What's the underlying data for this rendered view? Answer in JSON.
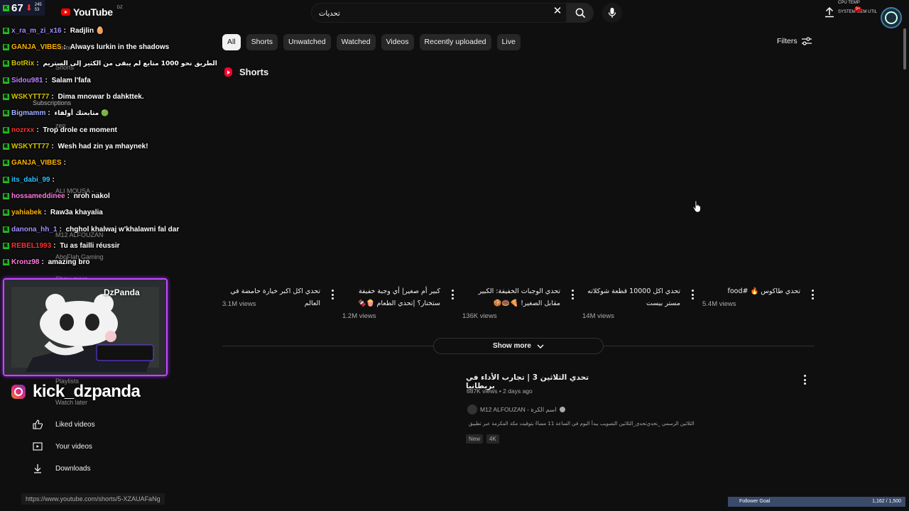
{
  "header": {
    "logo_text": "YouTube",
    "country": "DZ",
    "search_value": "تحديات",
    "sys_line1": "CPU TEMP",
    "sys_line2": "SYSTEM MEM UTIL",
    "notif_count": "9+"
  },
  "chips": [
    "All",
    "Shorts",
    "Unwatched",
    "Watched",
    "Videos",
    "Recently uploaded",
    "Live"
  ],
  "filters_label": "Filters",
  "shorts": {
    "heading": "Shorts",
    "items": [
      {
        "title": "تحدي اكل اكبر خيارة حامضة في العالم",
        "views": "3.1M views"
      },
      {
        "title": "كبير أم صغير| أي وجبة خفيفة ستختار؟ |تحدي الطعام 🍿🍫",
        "views": "1.2M views"
      },
      {
        "title": "تحدي الوجبات الخفيفة: الكبير مقابل الصغير! 🍕🍩🍪",
        "views": "136K views"
      },
      {
        "title": "تحدي اكل 10000 قطعة شوكلاته مستر بيست",
        "views": "14M views"
      },
      {
        "title": "تحدي طاكوس 🔥 #food",
        "views": "5.4M views"
      }
    ],
    "show_more": "Show more"
  },
  "video": {
    "title": "تحدي الثلاثين 3 | تجارب الأداء في بريطانيا",
    "meta": "687K views • 2 days ago",
    "channel": "M12 ALFOUZAN - اسم الكرة",
    "description": "الثلاثين الرسمي _تحدي‌تحدي_الثلاثين التصويب يبدأ اليوم في الساعة 11 مساءً بتوقيت مكة المكرمة عبر تطبيق",
    "badges": [
      "New",
      "4K"
    ]
  },
  "sidebar": {
    "faded": [
      "Home",
      "Shorts",
      "Subscriptions",
      "zen",
      "ALI MOUSA - ...",
      "M12 ALFOUZAN",
      "AboFlah Gaming",
      "Show more",
      "Playlists",
      "Watch later"
    ],
    "items": [
      {
        "label": "Liked videos",
        "icon": "thumbs-up-icon"
      },
      {
        "label": "Your videos",
        "icon": "video-icon"
      },
      {
        "label": "Downloads",
        "icon": "download-icon"
      }
    ]
  },
  "stream": {
    "viewers": "67",
    "stat_a": "245",
    "stat_b": "53",
    "chat": [
      {
        "user": "x_ra_m_zi_x16",
        "color": "#a58cff",
        "msg": "Radjlin 🥚"
      },
      {
        "user": "GANJA_VIBES",
        "color": "#ffb400",
        "msg": "Always lurkin in the shadows"
      },
      {
        "user": "BotRix",
        "color": "#d4c400",
        "msg": "الطريق نحو 1000 متابع لم يبقى من الكثير إلى الستريم"
      },
      {
        "user": "Sidou981",
        "color": "#c080ff",
        "msg": "Salam l'fafa"
      },
      {
        "user": "WSKYTT77",
        "color": "#d4c400",
        "msg": "Dima mnowar b dahkttek."
      },
      {
        "user": "Bigmamm",
        "color": "#9fb0ff",
        "msg": "متابعتك أولفاء 🟢"
      },
      {
        "user": "nozrxx",
        "color": "#ff3030",
        "msg": "Trop drole ce moment"
      },
      {
        "user": "WSKYTT77",
        "color": "#d4c400",
        "msg": "Wesh had zin ya mhaynek!"
      },
      {
        "user": "GANJA_VIBES",
        "color": "#ffb400",
        "msg": ""
      },
      {
        "user": "its_dabi_99",
        "color": "#30c0ff",
        "msg": ""
      },
      {
        "user": "hossameddinee",
        "color": "#ff7adf",
        "msg": "nroh nakol"
      },
      {
        "user": "yahiabek",
        "color": "#ffb400",
        "msg": "Raw3a khayalia"
      },
      {
        "user": "danona_hh_1",
        "color": "#a58cff",
        "msg": "chghol khalwaj w'khalawni fal dar"
      },
      {
        "user": "REBEL1993",
        "color": "#ff3030",
        "msg": "Tu as failli réussir"
      },
      {
        "user": "Kronz98",
        "color": "#ff7adf",
        "msg": "amazing bro"
      }
    ],
    "cam_name": "DzPanda",
    "handle": "kick_dzpanda",
    "follower_goal": "Follower Goal",
    "follower_count": "1,162 / 1,500"
  },
  "status_url": "https://www.youtube.com/shorts/5-XZAUAFaNg"
}
